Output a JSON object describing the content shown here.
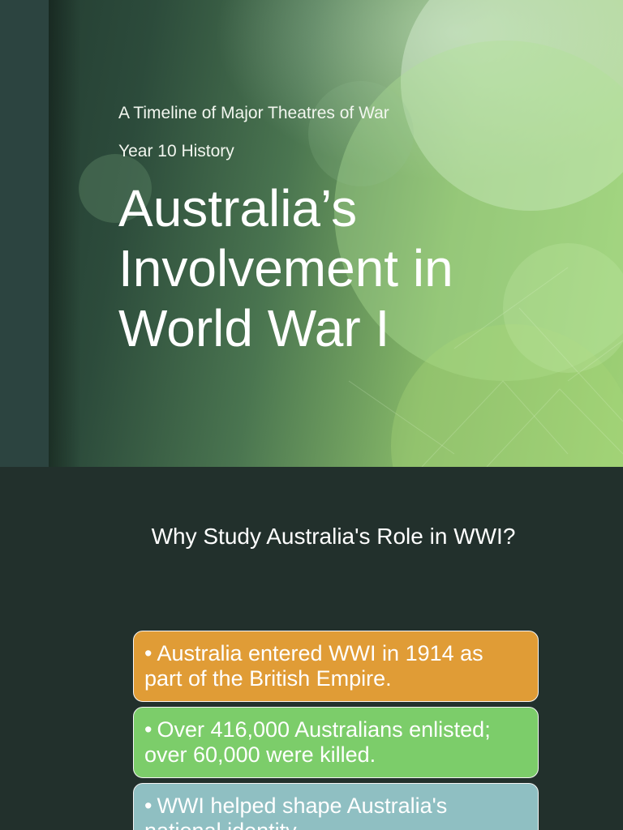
{
  "slide1": {
    "subtitle_1": "A Timeline of Major Theatres of War",
    "subtitle_2": "Year 10 History",
    "title_lines": [
      "Australia’s",
      "Involvement in",
      "World War I"
    ]
  },
  "slide2": {
    "heading": "Why Study Australia's Role in WWI?",
    "bullet_glyph": "•",
    "facts": [
      {
        "text": "Australia entered WWI in 1914 as part of the British Empire.",
        "color": "#e09c36"
      },
      {
        "text": "Over 416,000 Australians enlisted; over 60,000 were killed.",
        "color": "#7ccd6a"
      },
      {
        "text": "WWI helped shape Australia's national identity.",
        "color": "#8fbfc2"
      }
    ]
  },
  "colors": {
    "background_dark": "#22302c",
    "title_text": "#ffffff"
  }
}
